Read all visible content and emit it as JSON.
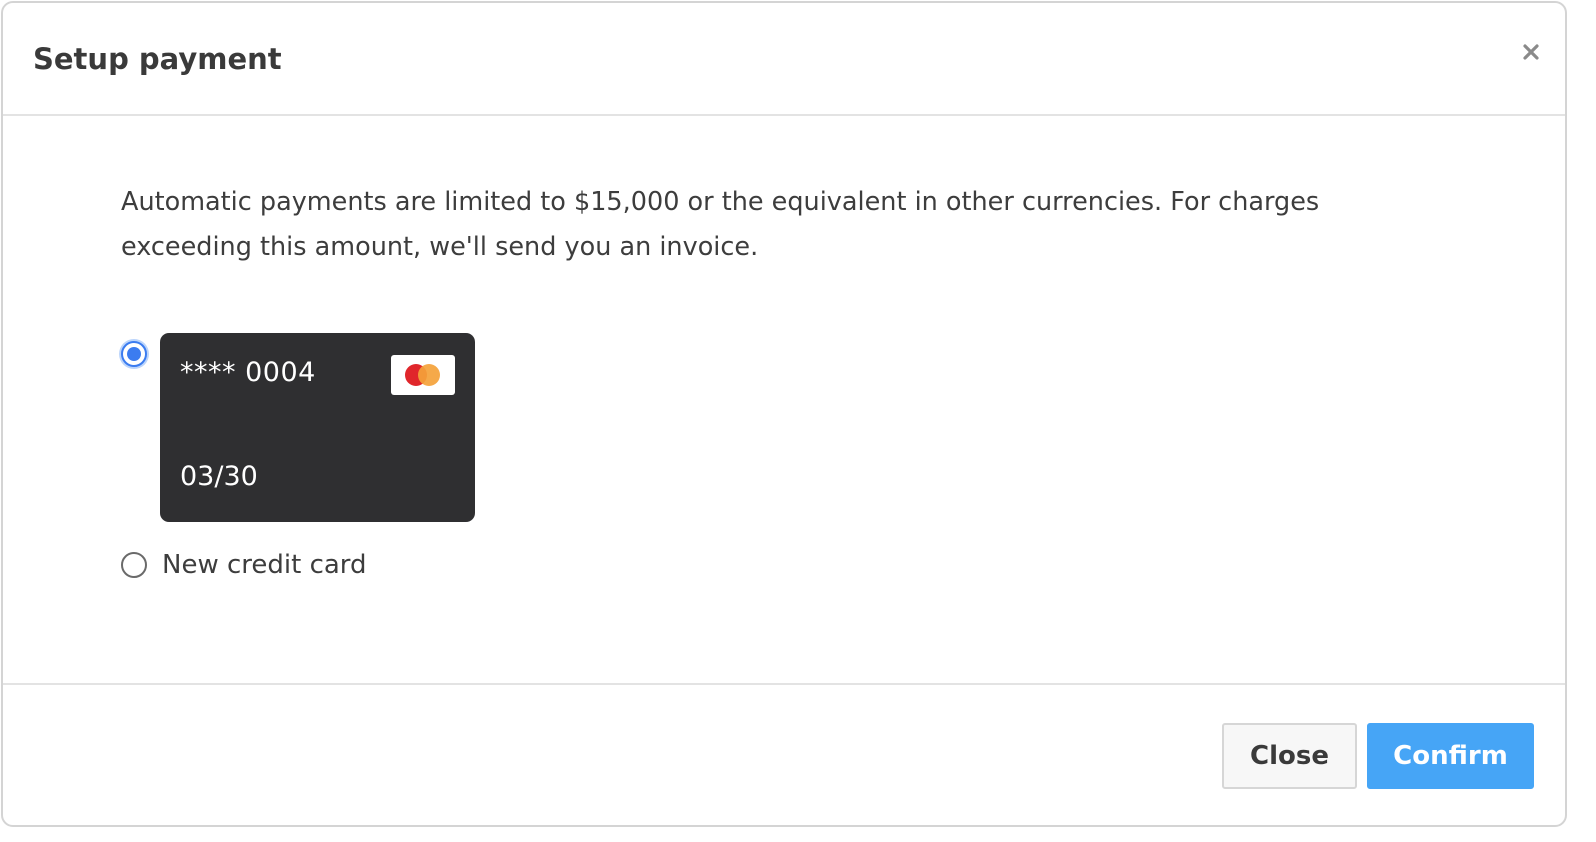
{
  "modal": {
    "title": "Setup payment"
  },
  "notice": "Automatic payments are limited to $15,000 or the equivalent in other currencies. For charges exceeding this amount, we'll send you an invoice.",
  "payment_options": {
    "saved_card": {
      "selected": true,
      "masked_number": "**** 0004",
      "expiry": "03/30",
      "brand_icon": "mastercard-logo"
    },
    "new_card": {
      "selected": false,
      "label": "New credit card"
    }
  },
  "footer": {
    "close_label": "Close",
    "confirm_label": "Confirm"
  },
  "icons": {
    "dismiss": "close-icon"
  },
  "colors": {
    "primary": "#46a5f6",
    "radio_selected": "#3b7cf0",
    "card_background": "#2f2f31",
    "mastercard_red": "#e0262b",
    "mastercard_orange": "#f4a23a"
  }
}
